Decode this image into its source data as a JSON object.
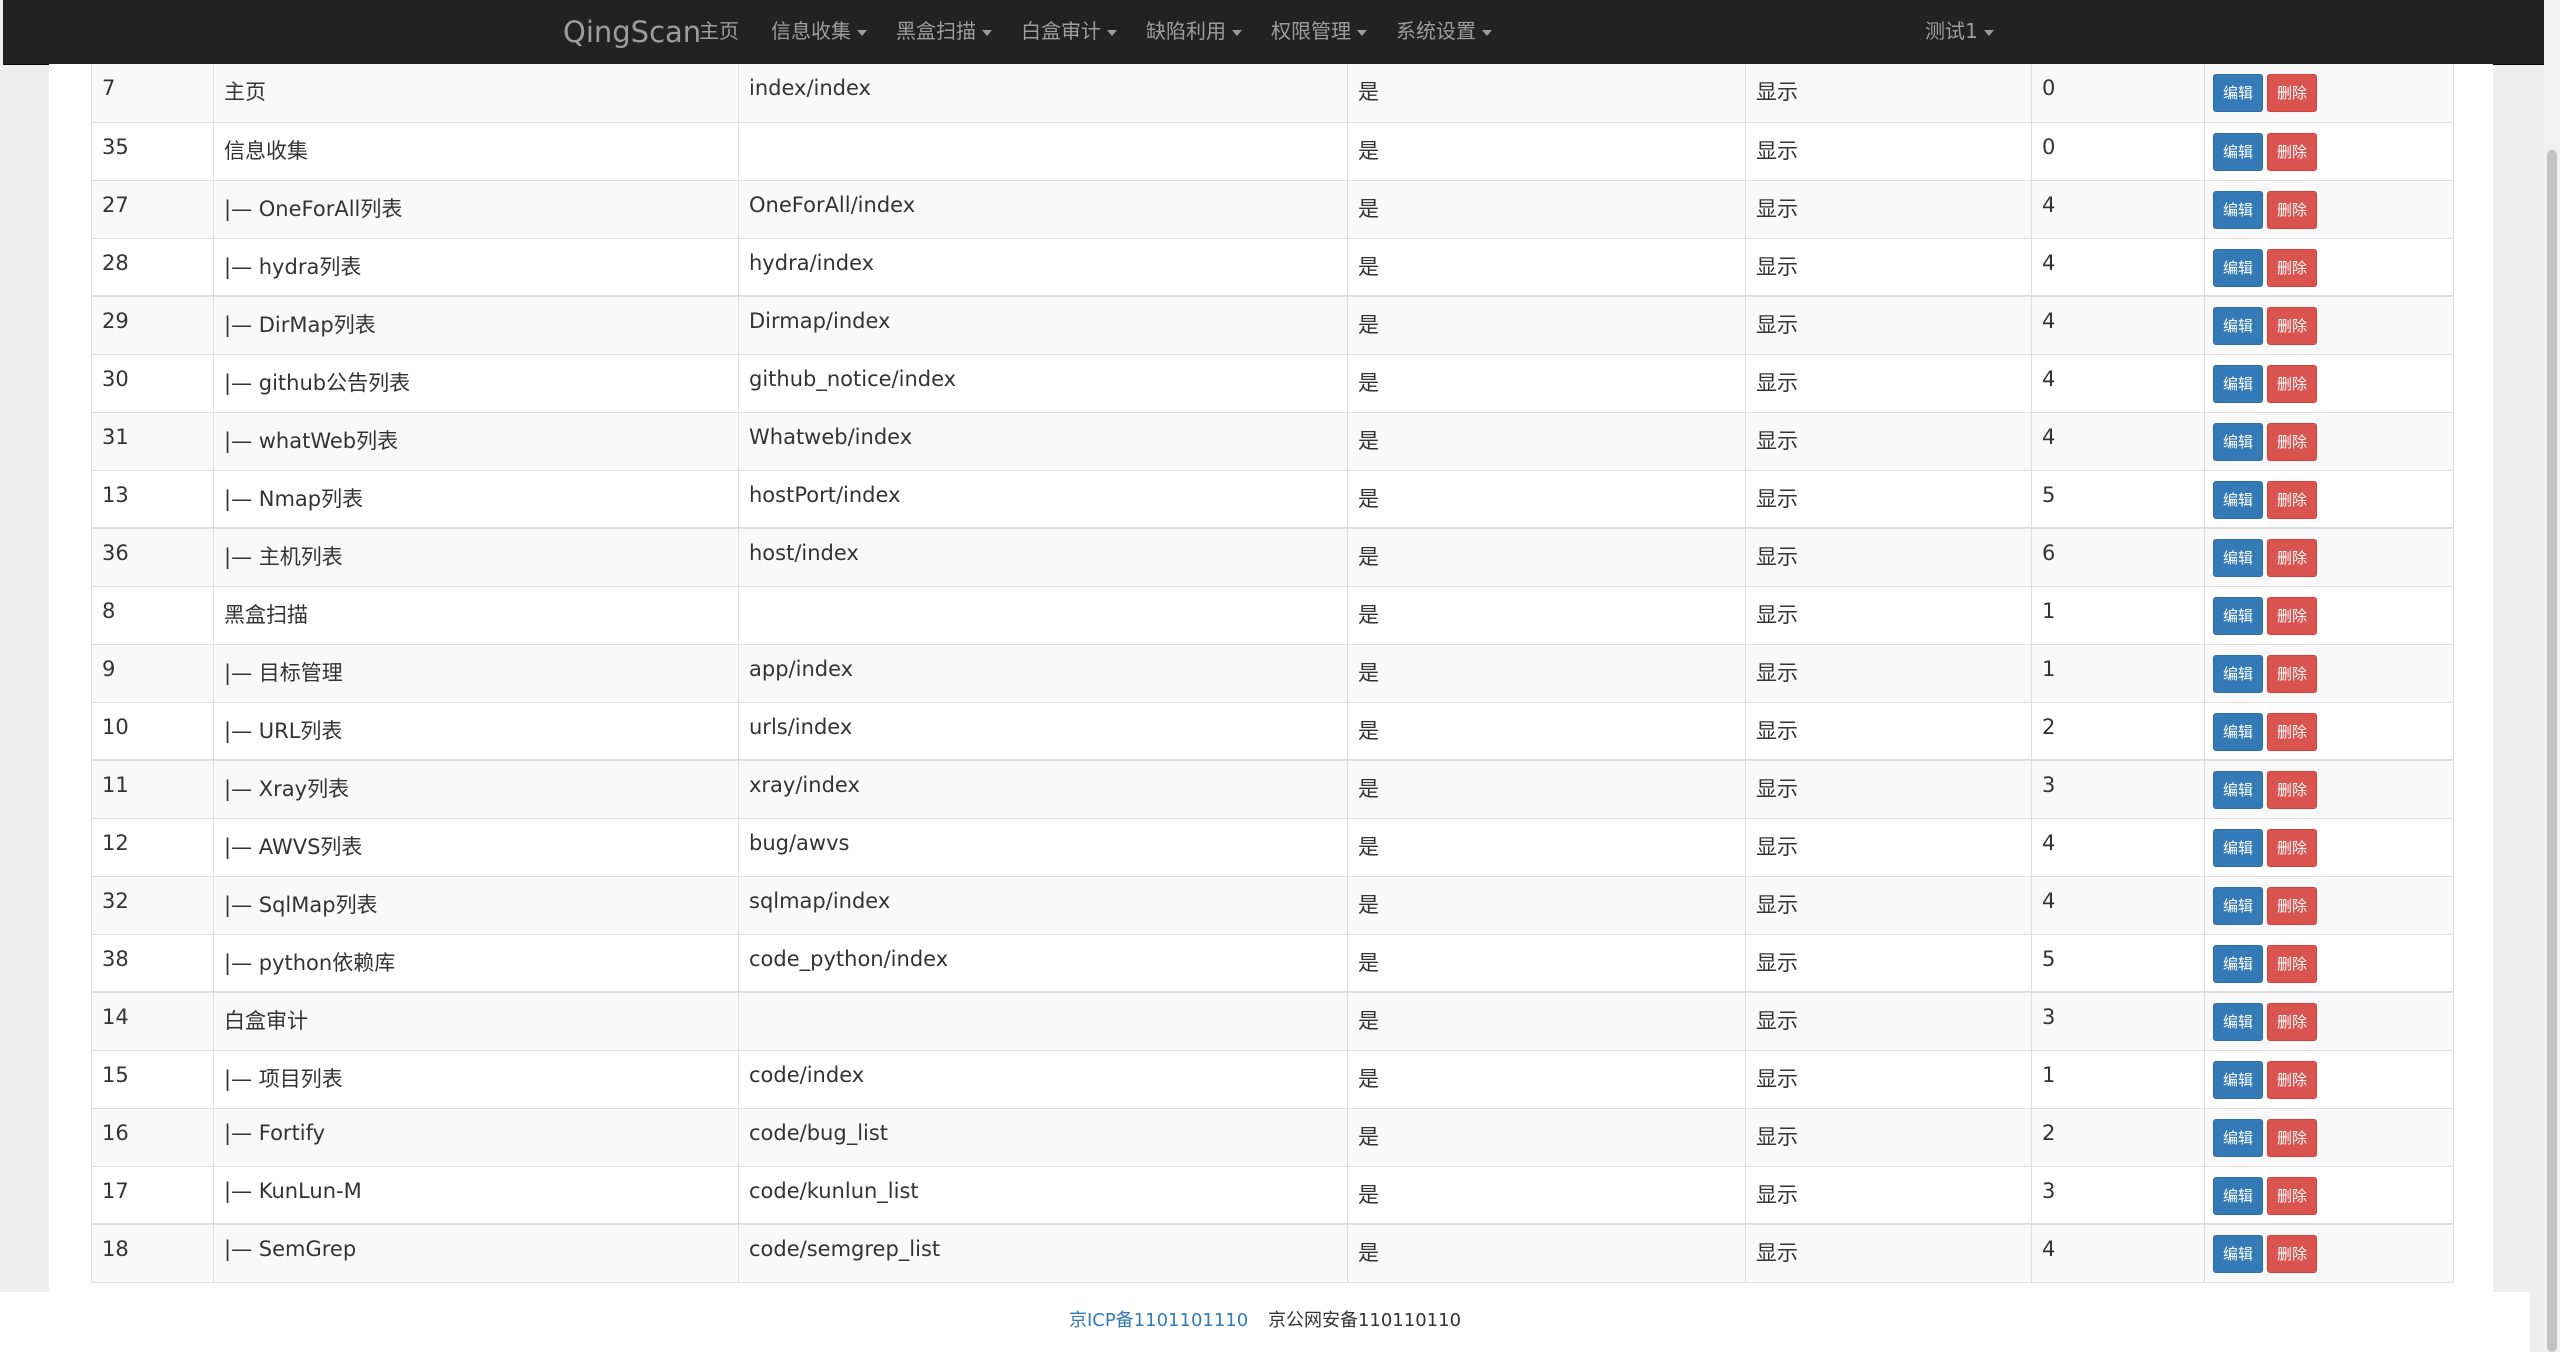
{
  "nav": {
    "brand": "QingScan",
    "items": [
      {
        "label": "主页",
        "dropdown": false
      },
      {
        "label": "信息收集",
        "dropdown": true
      },
      {
        "label": "黑盒扫描",
        "dropdown": true
      },
      {
        "label": "白盒审计",
        "dropdown": true
      },
      {
        "label": "缺陷利用",
        "dropdown": true
      },
      {
        "label": "权限管理",
        "dropdown": true
      },
      {
        "label": "系统设置",
        "dropdown": true
      }
    ],
    "user": "测试1"
  },
  "table": {
    "edit_label": "编辑",
    "delete_label": "删除",
    "rows": [
      {
        "id": "7",
        "name": "主页",
        "path": "index/index",
        "flag": "是",
        "status": "显示",
        "order": "0"
      },
      {
        "id": "35",
        "name": "信息收集",
        "path": "",
        "flag": "是",
        "status": "显示",
        "order": "0"
      },
      {
        "id": "27",
        "name": "|— OneForAll列表",
        "path": "OneForAll/index",
        "flag": "是",
        "status": "显示",
        "order": "4"
      },
      {
        "id": "28",
        "name": "|— hydra列表",
        "path": "hydra/index",
        "flag": "是",
        "status": "显示",
        "order": "4"
      },
      {
        "id": "29",
        "name": "|— DirMap列表",
        "path": "Dirmap/index",
        "flag": "是",
        "status": "显示",
        "order": "4"
      },
      {
        "id": "30",
        "name": "|— github公告列表",
        "path": "github_notice/index",
        "flag": "是",
        "status": "显示",
        "order": "4"
      },
      {
        "id": "31",
        "name": "|— whatWeb列表",
        "path": "Whatweb/index",
        "flag": "是",
        "status": "显示",
        "order": "4"
      },
      {
        "id": "13",
        "name": "|— Nmap列表",
        "path": "hostPort/index",
        "flag": "是",
        "status": "显示",
        "order": "5"
      },
      {
        "id": "36",
        "name": "|— 主机列表",
        "path": "host/index",
        "flag": "是",
        "status": "显示",
        "order": "6"
      },
      {
        "id": "8",
        "name": "黑盒扫描",
        "path": "",
        "flag": "是",
        "status": "显示",
        "order": "1"
      },
      {
        "id": "9",
        "name": "|— 目标管理",
        "path": "app/index",
        "flag": "是",
        "status": "显示",
        "order": "1"
      },
      {
        "id": "10",
        "name": "|— URL列表",
        "path": "urls/index",
        "flag": "是",
        "status": "显示",
        "order": "2"
      },
      {
        "id": "11",
        "name": "|— Xray列表",
        "path": "xray/index",
        "flag": "是",
        "status": "显示",
        "order": "3"
      },
      {
        "id": "12",
        "name": "|— AWVS列表",
        "path": "bug/awvs",
        "flag": "是",
        "status": "显示",
        "order": "4"
      },
      {
        "id": "32",
        "name": "|— SqlMap列表",
        "path": "sqlmap/index",
        "flag": "是",
        "status": "显示",
        "order": "4"
      },
      {
        "id": "38",
        "name": "|— python依赖库",
        "path": "code_python/index",
        "flag": "是",
        "status": "显示",
        "order": "5"
      },
      {
        "id": "14",
        "name": "白盒审计",
        "path": "",
        "flag": "是",
        "status": "显示",
        "order": "3"
      },
      {
        "id": "15",
        "name": "|— 项目列表",
        "path": "code/index",
        "flag": "是",
        "status": "显示",
        "order": "1"
      },
      {
        "id": "16",
        "name": "|— Fortify",
        "path": "code/bug_list",
        "flag": "是",
        "status": "显示",
        "order": "2"
      },
      {
        "id": "17",
        "name": "|— KunLun-M",
        "path": "code/kunlun_list",
        "flag": "是",
        "status": "显示",
        "order": "3"
      },
      {
        "id": "18",
        "name": "|— SemGrep",
        "path": "code/semgrep_list",
        "flag": "是",
        "status": "显示",
        "order": "4"
      }
    ]
  },
  "footer": {
    "icp": "京ICP备1101101110",
    "police": "京公网安备110110110"
  },
  "colors": {
    "navbar": "#222222",
    "edit_button": "#337ab7",
    "delete_button": "#d9534f",
    "link": "#337ab7"
  }
}
